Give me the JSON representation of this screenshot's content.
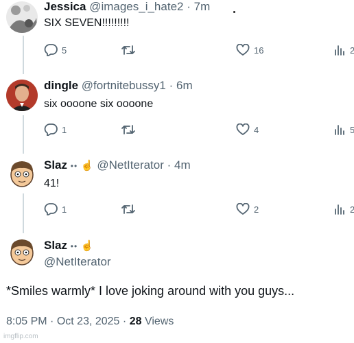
{
  "tweets": [
    {
      "name": "Jessica",
      "handle": "@images_i_hate2",
      "separator": "·",
      "time": "7m",
      "text": "SIX SEVEN!!!!!!!!!",
      "replies": "5",
      "likes": "16",
      "views": "2"
    },
    {
      "name": "dingle",
      "handle": "@fortnitebussy1",
      "separator": "·",
      "time": "6m",
      "text": "six oooone six oooone",
      "replies": "1",
      "likes": "4",
      "views": "5"
    },
    {
      "name": "Slaz",
      "emoji": "••",
      "hand": "☝",
      "handle": "@NetIterator",
      "separator": "·",
      "time": "4m",
      "text": "41!",
      "replies": "1",
      "likes": "2",
      "views": "2"
    }
  ],
  "main_tweet": {
    "name": "Slaz",
    "emoji": "••",
    "hand": "☝",
    "handle": "@NetIterator",
    "text": "*Smiles warmly* I love joking around with you guys...",
    "time": "8:05 PM",
    "separator": "·",
    "date": "Oct 23, 2025",
    "views_count": "28",
    "views_label": "Views"
  },
  "watermark": "imgflip.com",
  "icons": [
    "reply-icon",
    "retweet-icon",
    "like-icon",
    "views-icon"
  ],
  "colors": {
    "text": "#0f1419",
    "secondary": "#536471",
    "line": "#cfd9de"
  }
}
